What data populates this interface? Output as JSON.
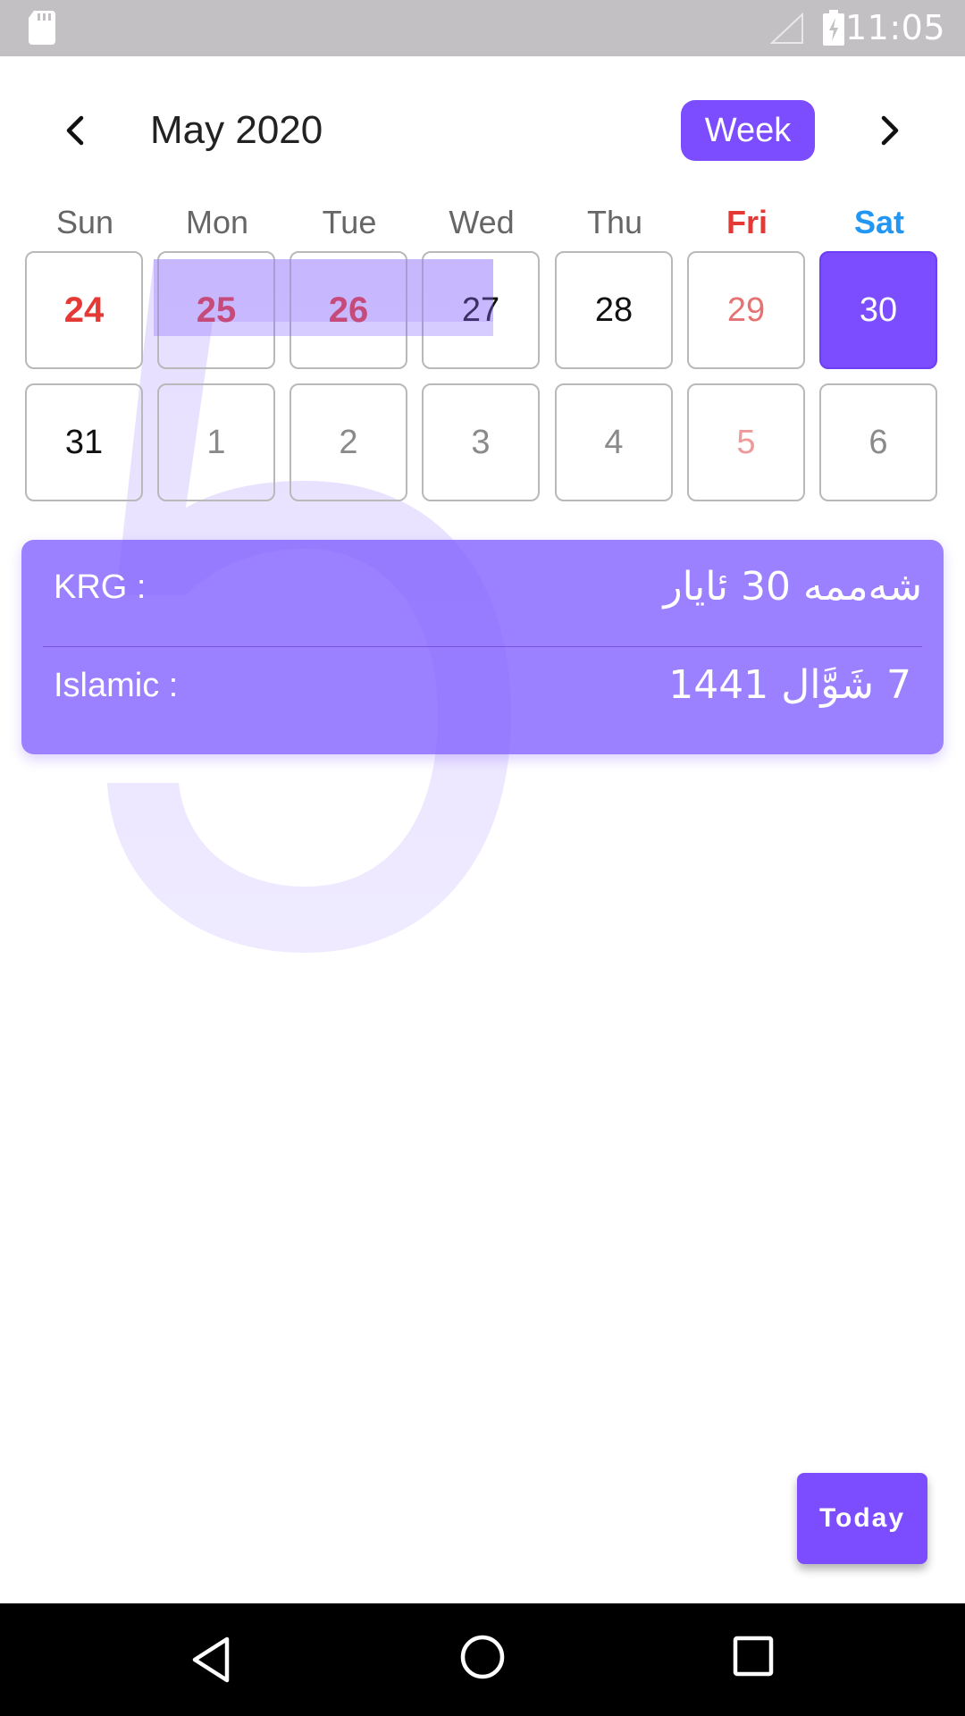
{
  "status_bar": {
    "time": "11:05",
    "icons": [
      "sd-card-icon",
      "signal-icon",
      "battery-charging-icon"
    ]
  },
  "header": {
    "month_title": "May 2020",
    "view_toggle_label": "Week",
    "prev_icon": "chevron-left-icon",
    "next_icon": "chevron-right-icon"
  },
  "watermark_digit": "5",
  "weekdays": [
    "Sun",
    "Mon",
    "Tue",
    "Wed",
    "Thu",
    "Fri",
    "Sat"
  ],
  "weeks": [
    [
      {
        "day": "24",
        "style": "holiday"
      },
      {
        "day": "25",
        "style": "holiday"
      },
      {
        "day": "26",
        "style": "holiday"
      },
      {
        "day": "27",
        "style": "normal"
      },
      {
        "day": "28",
        "style": "normal"
      },
      {
        "day": "29",
        "style": "friday"
      },
      {
        "day": "30",
        "style": "selected"
      }
    ],
    [
      {
        "day": "31",
        "style": "normal"
      },
      {
        "day": "1",
        "style": "other-month"
      },
      {
        "day": "2",
        "style": "other-month"
      },
      {
        "day": "3",
        "style": "other-month"
      },
      {
        "day": "4",
        "style": "other-month"
      },
      {
        "day": "5",
        "style": "other-month-friday"
      },
      {
        "day": "6",
        "style": "other-month"
      }
    ]
  ],
  "info_card": {
    "krg_label": "KRG :",
    "krg_value": "شەممە 30 ئایار",
    "islamic_label": "Islamic :",
    "islamic_value": "7 شَوَّال 1441"
  },
  "today_button_label": "Today",
  "colors": {
    "accent": "#7b4dff",
    "holiday_red": "#e53935",
    "saturday_blue": "#2196f3",
    "status_bar": "#c2c0c3"
  },
  "nav_bar": {
    "icons": [
      "back-icon",
      "home-icon",
      "recents-icon"
    ]
  }
}
